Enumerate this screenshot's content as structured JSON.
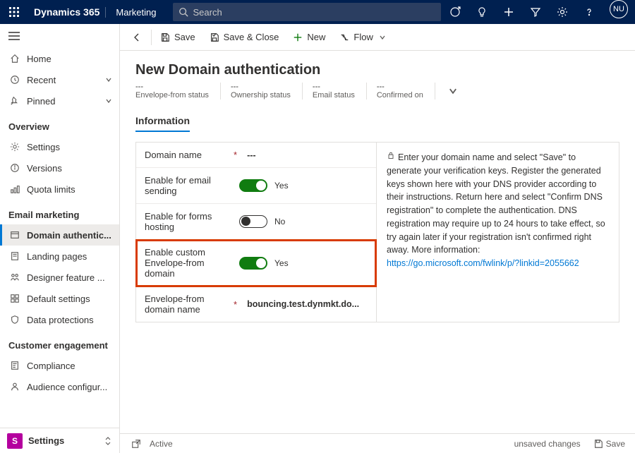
{
  "topbar": {
    "brand": "Dynamics 365",
    "module": "Marketing",
    "search_placeholder": "Search",
    "avatar": "NU"
  },
  "sidebar": {
    "items": {
      "home": "Home",
      "recent": "Recent",
      "pinned": "Pinned"
    },
    "groups": [
      {
        "heading": "Overview",
        "items": [
          {
            "icon": "gear",
            "label": "Settings"
          },
          {
            "icon": "info",
            "label": "Versions"
          },
          {
            "icon": "quota",
            "label": "Quota limits"
          }
        ]
      },
      {
        "heading": "Email marketing",
        "items": [
          {
            "icon": "auth",
            "label": "Domain authentic...",
            "active": true
          },
          {
            "icon": "page",
            "label": "Landing pages"
          },
          {
            "icon": "designer",
            "label": "Designer feature ..."
          },
          {
            "icon": "defaults",
            "label": "Default settings"
          },
          {
            "icon": "shield",
            "label": "Data protections"
          }
        ]
      },
      {
        "heading": "Customer engagement",
        "items": [
          {
            "icon": "compliance",
            "label": "Compliance"
          },
          {
            "icon": "audconf",
            "label": "Audience configur..."
          }
        ]
      }
    ],
    "area": {
      "badge": "S",
      "label": "Settings"
    }
  },
  "cmdbar": {
    "save": "Save",
    "save_close": "Save & Close",
    "new": "New",
    "flow": "Flow"
  },
  "page": {
    "title": "New Domain authentication",
    "status": [
      {
        "label": "Envelope-from status",
        "value": "---"
      },
      {
        "label": "Ownership status",
        "value": "---"
      },
      {
        "label": "Email status",
        "value": "---"
      },
      {
        "label": "Confirmed on",
        "value": "---"
      }
    ],
    "tab": "Information"
  },
  "form": {
    "fields": {
      "domain_name": {
        "label": "Domain name",
        "required": true,
        "value": "---"
      },
      "email_sending": {
        "label": "Enable for email sending",
        "on": true,
        "text": "Yes"
      },
      "forms_hosting": {
        "label": "Enable for forms hosting",
        "on": false,
        "text": "No"
      },
      "custom_envelope": {
        "label": "Enable custom Envelope-from domain",
        "on": true,
        "text": "Yes",
        "highlight": true
      },
      "envelope_domain": {
        "label": "Envelope-from domain name",
        "required": true,
        "value": "bouncing.test.dynmkt.do..."
      }
    },
    "help": {
      "text": "Enter your domain name and select \"Save\" to generate your verification keys. Register the generated keys shown here with your DNS provider according to their instructions. Return here and select \"Confirm DNS registration\" to complete the authentication. DNS registration may require up to 24 hours to take effect, so try again later if your registration isn't confirmed right away. More information:",
      "link": "https://go.microsoft.com/fwlink/p/?linkid=2055662"
    }
  },
  "footer": {
    "status": "Active",
    "unsaved": "unsaved changes",
    "save": "Save"
  }
}
